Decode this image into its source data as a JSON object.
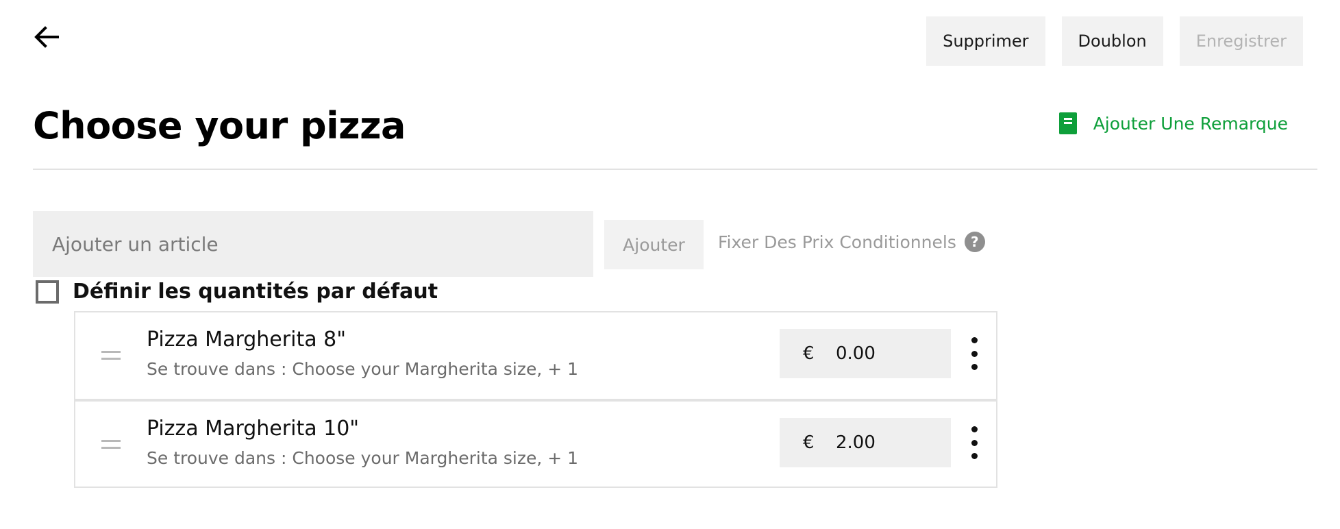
{
  "header": {
    "buttons": {
      "delete": "Supprimer",
      "duplicate": "Doublon",
      "save": "Enregistrer"
    }
  },
  "page": {
    "title": "Choose your pizza",
    "add_note_label": "Ajouter Une Remarque"
  },
  "article": {
    "placeholder": "Ajouter un article",
    "value": "",
    "add_button": "Ajouter",
    "conditional_pricing": "Fixer Des Prix Conditionnels",
    "help_symbol": "?"
  },
  "default_quantities": {
    "label": "Définir les quantités par défaut",
    "checked": false
  },
  "items": [
    {
      "name": "Pizza Margherita 8\"",
      "location": "Se trouve dans : Choose your Margherita size, + 1",
      "currency": "€",
      "price": "0.00"
    },
    {
      "name": "Pizza Margherita 10\"",
      "location": "Se trouve dans : Choose your Margherita size, + 1",
      "currency": "€",
      "price": "2.00"
    }
  ],
  "colors": {
    "accent": "#0e9f3a",
    "disabled_text": "#b3b3b3",
    "field_background": "#efefef"
  },
  "icons": {
    "back": "arrow-left-icon",
    "note": "note-icon",
    "help": "question-circle-icon",
    "drag": "drag-handle-icon",
    "more": "more-vertical-icon"
  }
}
